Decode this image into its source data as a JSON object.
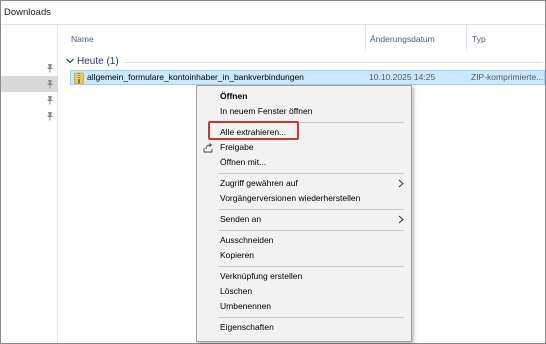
{
  "window": {
    "title": "Downloads"
  },
  "columns": {
    "name": "Name",
    "date": "Änderungsdatum",
    "type": "Typ"
  },
  "group": {
    "label": "Heute (1)"
  },
  "file": {
    "name": "allgemein_formulare_kontoinhaber_in_bankverbindungen",
    "date": "10.10.2025 14:25",
    "type": "ZIP-komprimierte..."
  },
  "context_menu": {
    "open": "Öffnen",
    "open_new_window": "In neuem Fenster öffnen",
    "extract_all": "Alle extrahieren...",
    "share": "Freigabe",
    "open_with": "Öffnen mit...",
    "give_access": "Zugriff gewähren auf",
    "restore_versions": "Vorgängerversionen wiederherstellen",
    "send_to": "Senden an",
    "cut": "Ausschneiden",
    "copy": "Kopieren",
    "create_shortcut": "Verknüpfung erstellen",
    "delete": "Löschen",
    "rename": "Umbenennen",
    "properties": "Eigenschaften"
  },
  "icons": {
    "pin": "pin-icon",
    "zip": "zip-folder-icon",
    "share": "share-icon",
    "submenu": "chevron-right-icon",
    "group": "chevron-down-icon"
  },
  "colors": {
    "selection": "#cce8ff",
    "selection_border": "#99d1ff",
    "highlight_box": "#c0393b",
    "group_text": "#1e3e70",
    "menu_bg": "#f2f2f2"
  }
}
